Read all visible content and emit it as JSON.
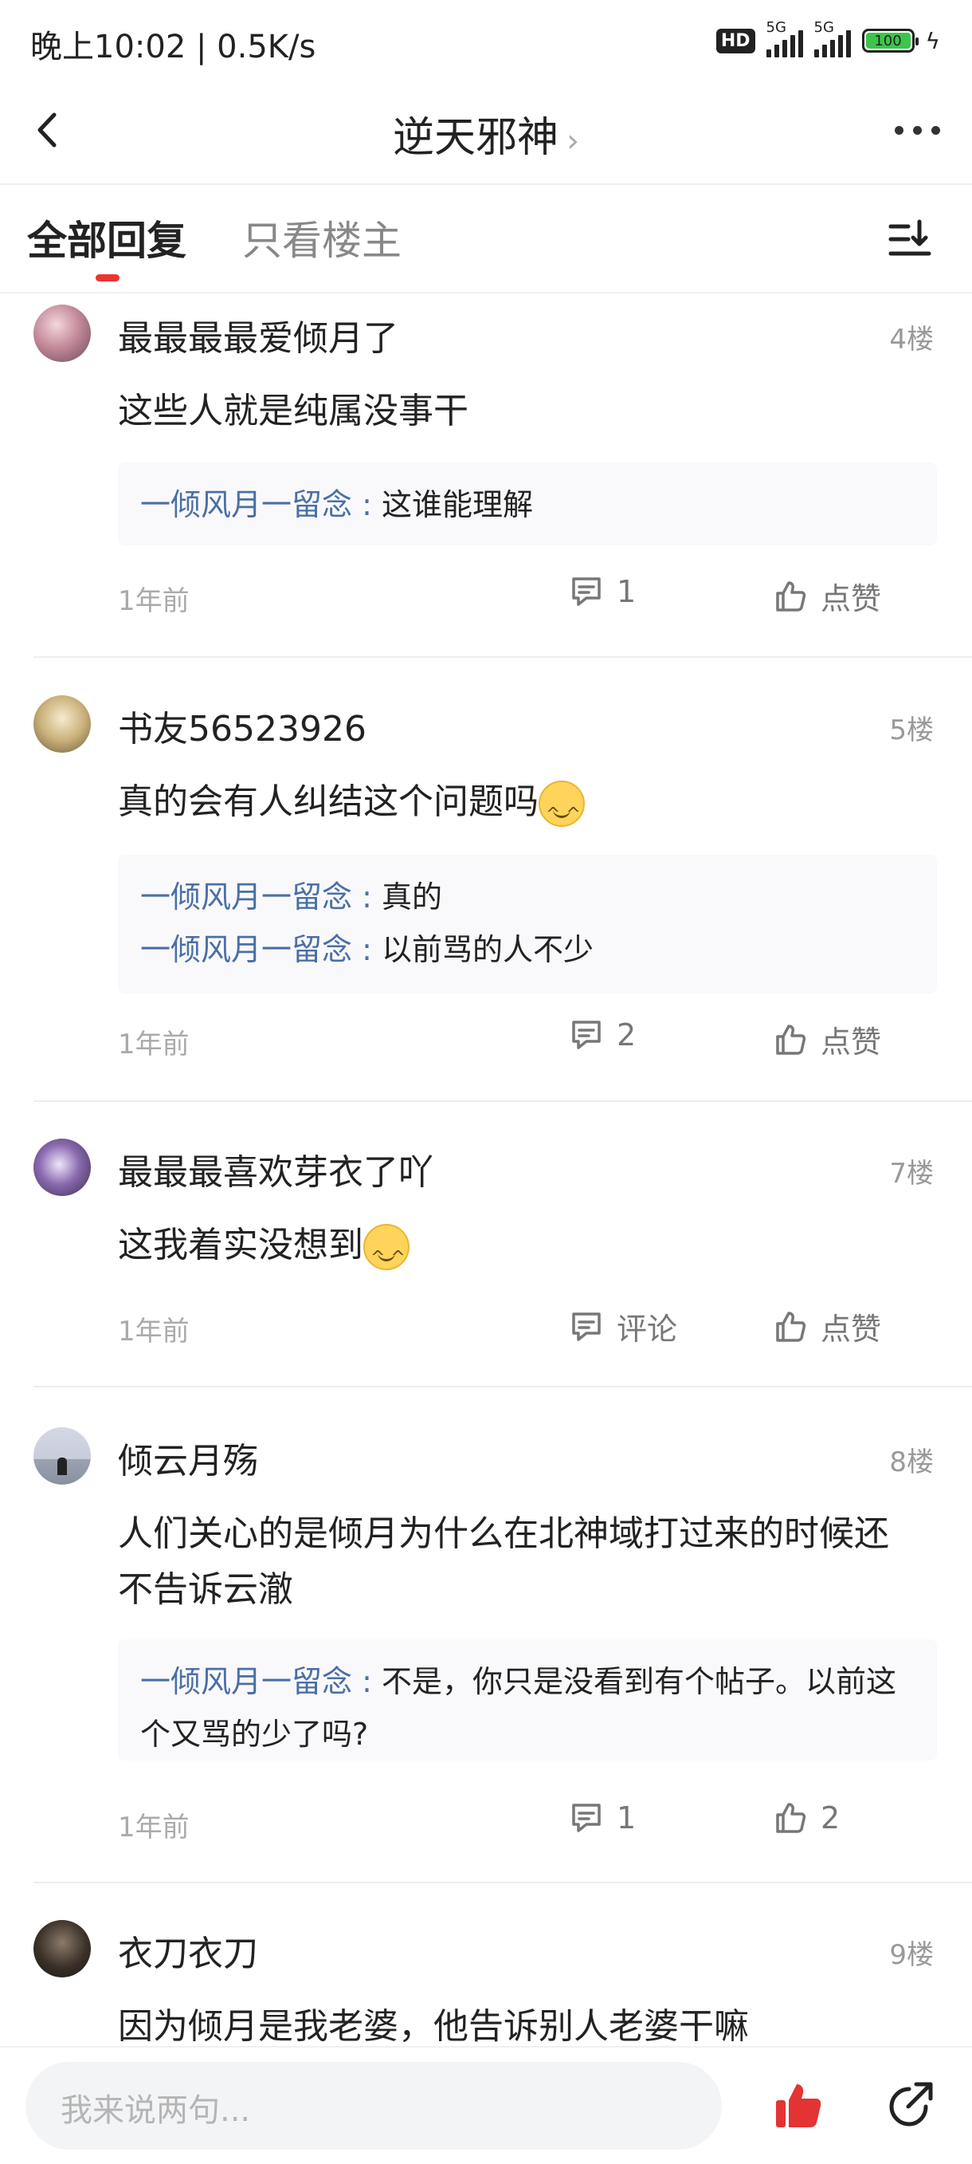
{
  "status_bar": {
    "time": "晚上10:02 | 0.5K/s",
    "hd_label": "HD",
    "sim1_label": "5G",
    "sim2_label": "5G",
    "battery": "100"
  },
  "nav": {
    "title": "逆天邪神",
    "chevron": "›"
  },
  "tabs": {
    "all": "全部回复",
    "owner": "只看楼主"
  },
  "posts": [
    {
      "name": "最最最最爱倾月了",
      "floor": "4楼",
      "content": "这些人就是纯属没事干",
      "replies": [
        {
          "user": "一倾风月一留念 :",
          "text": " 这谁能理解"
        }
      ],
      "time": "1年前",
      "comments": "1",
      "likes": "点赞"
    },
    {
      "name": "书友56523926",
      "floor": "5楼",
      "content": "真的会有人纠结这个问题吗",
      "replies": [
        {
          "user": "一倾风月一留念 :",
          "text": " 真的"
        },
        {
          "user": "一倾风月一留念 :",
          "text": " 以前骂的人不少"
        }
      ],
      "time": "1年前",
      "comments": "2",
      "likes": "点赞"
    },
    {
      "name": "最最最喜欢芽衣了吖",
      "floor": "7楼",
      "content": "这我着实没想到",
      "replies": [],
      "time": "1年前",
      "comments": "评论",
      "likes": "点赞"
    },
    {
      "name": "倾云月殇",
      "floor": "8楼",
      "content": "人们关心的是倾月为什么在北神域打过来的时候还不告诉云澈",
      "replies": [
        {
          "user": "一倾风月一留念 :",
          "text": " 不是，你只是没看到有个帖子。以前这个又骂的少了吗?"
        }
      ],
      "time": "1年前",
      "comments": "1",
      "likes": "2"
    },
    {
      "name": "衣刀衣刀",
      "floor": "9楼",
      "content": "因为倾月是我老婆，他告诉别人老婆干嘛"
    }
  ],
  "input": {
    "placeholder": "我来说两句..."
  },
  "colors": {
    "accent": "#e33333",
    "reply_user": "#4a6fa5",
    "battery": "#3cc54a"
  }
}
